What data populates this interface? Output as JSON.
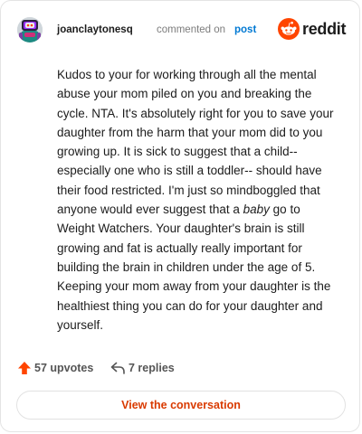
{
  "header": {
    "username": "joanclaytonesq",
    "commented_on": "commented on",
    "post_link": "post",
    "brand": "reddit",
    "brand_color": "#ff4500",
    "avatar_icon": "snoo-avatar-icon"
  },
  "comment": {
    "text_before_emphasis": "Kudos to your for working through all the mental abuse your mom piled on you and breaking the cycle. NTA. It's absolutely right for you to save your daughter from the harm that your mom did to you growing up. It is sick to suggest that a child-- especially one who is still a toddler-- should have their food restricted. I'm just so mindboggled that anyone would ever suggest that a ",
    "emphasis": "baby",
    "text_after_emphasis": " go to Weight Watchers. Your daughter's brain is still growing and fat is actually really important for building the brain in children under the age of 5. Keeping your mom away from your daughter is the healthiest thing you can do for your daughter and yourself."
  },
  "footer": {
    "upvotes": "57 upvotes",
    "replies": "7 replies",
    "upvote_icon": "upvote-arrow-icon",
    "reply_icon": "reply-arrow-icon",
    "upvote_color": "#ff4500"
  },
  "actions": {
    "view_conversation": "View the conversation",
    "button_text_color": "#d93a00"
  }
}
